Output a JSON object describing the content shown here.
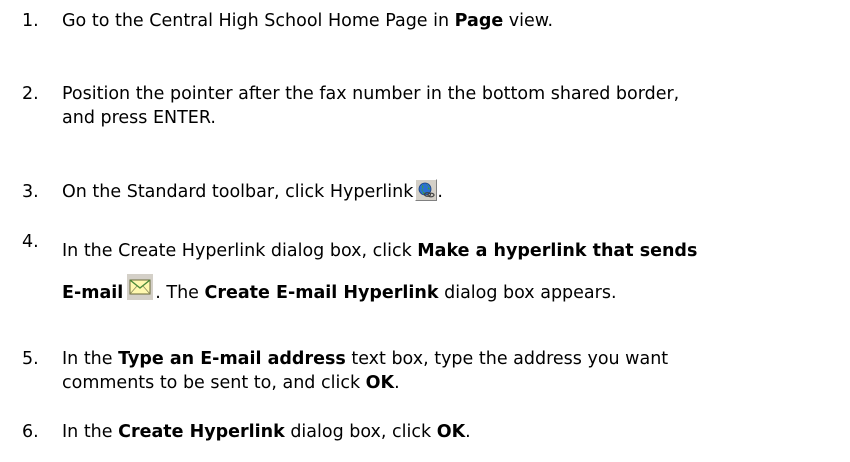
{
  "steps": [
    {
      "number": "1.",
      "parts": [
        "Go to the Central High School Home Page in ",
        "Page",
        " view."
      ]
    },
    {
      "number": "2.",
      "line1": "Position the pointer after the fax number in the bottom shared border,",
      "line2": "and press ENTER."
    },
    {
      "number": "3.",
      "before": "On the Standard toolbar, click Hyperlink",
      "after": ".",
      "icon": "hyperlink-globe-icon"
    },
    {
      "number": "4.",
      "l1_before": "In the Create Hyperlink dialog box, click ",
      "l1_bold": "Make a hyperlink that sends",
      "l2_bold1": "E-mail",
      "l2_mid": ". The ",
      "l2_bold2": "Create E-mail Hyperlink",
      "l2_after": " dialog box appears.",
      "icon": "envelope-icon"
    },
    {
      "number": "5.",
      "l1_before": "In the ",
      "l1_bold": "Type an E-mail address",
      "l1_after": " text box, type the address you want",
      "l2_before": "comments to be sent to, and click ",
      "l2_bold": "OK",
      "l2_after": "."
    },
    {
      "number": "6.",
      "before": "In the ",
      "bold1": "Create Hyperlink",
      "mid": " dialog box, click ",
      "bold2": "OK",
      "after": "."
    }
  ]
}
